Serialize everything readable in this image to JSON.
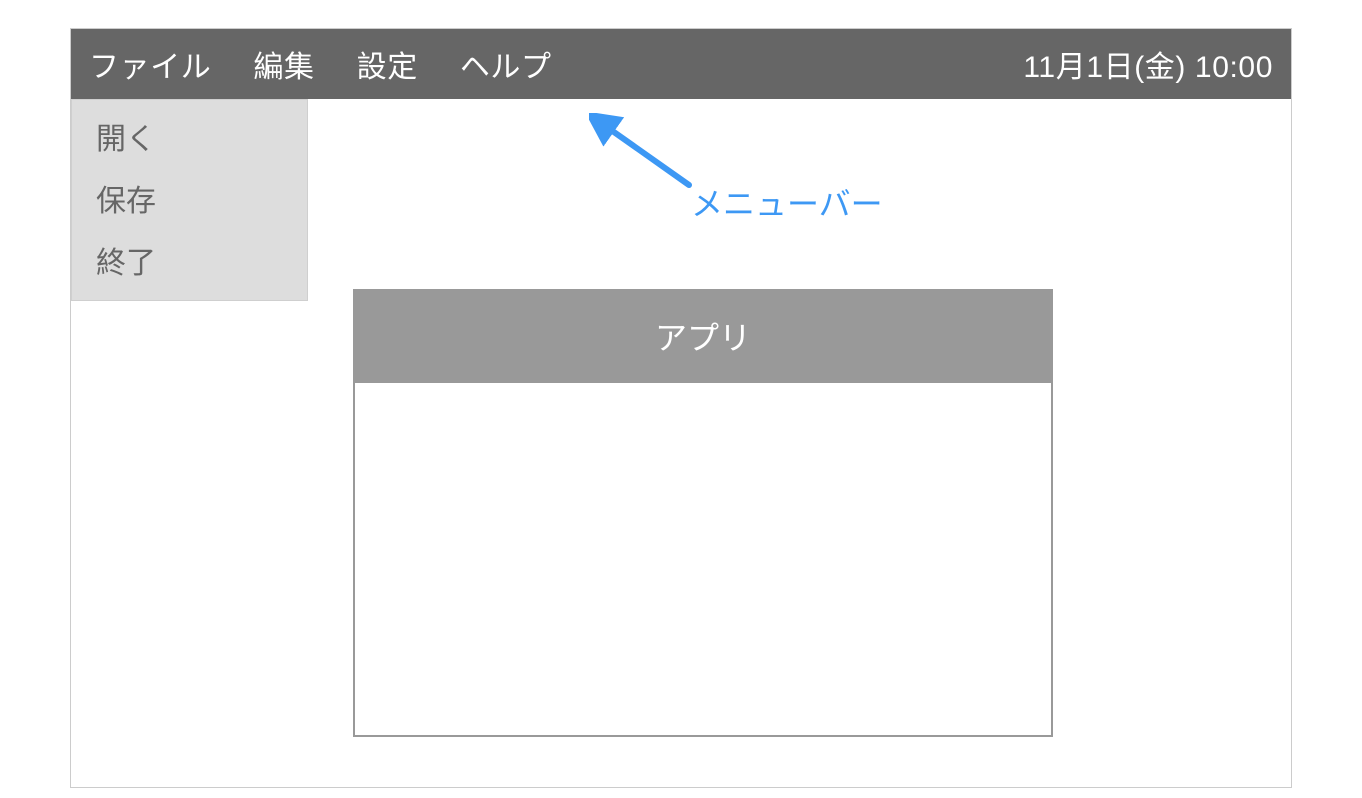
{
  "menubar": {
    "items": [
      "ファイル",
      "編集",
      "設定",
      "ヘルプ"
    ],
    "datetime": "11月1日(金) 10:00"
  },
  "dropdown": {
    "items": [
      "開く",
      "保存",
      "終了"
    ]
  },
  "app_window": {
    "title": "アプリ"
  },
  "annotation": {
    "label": "メニューバー",
    "color": "#3d98f4"
  }
}
